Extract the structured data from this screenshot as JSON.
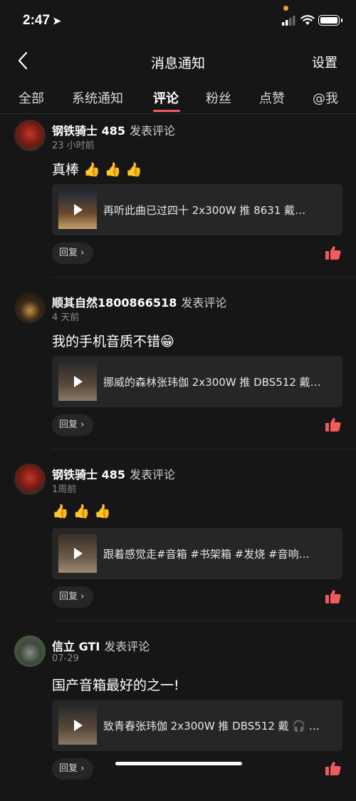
{
  "status_bar": {
    "time": "2:47",
    "location_glyph": "➤"
  },
  "nav": {
    "title": "消息通知",
    "settings": "设置",
    "back_icon": "chevron-left-icon"
  },
  "tabs": [
    {
      "label": "全部"
    },
    {
      "label": "系统通知"
    },
    {
      "label": "评论",
      "active": true
    },
    {
      "label": "粉丝"
    },
    {
      "label": "点赞"
    },
    {
      "label": "@我"
    }
  ],
  "colors": {
    "accent": "#f15a5f",
    "background": "#161616",
    "card": "#262626"
  },
  "comments": [
    {
      "user": "钢铁骑士 485",
      "action": "发表评论",
      "time": "23 小时前",
      "content": "真棒 👍 👍 👍",
      "video_title": "再听此曲已过四十 2x300W 推 8631 戴…",
      "reply": "回复 ›"
    },
    {
      "user": "顺其自然1800866518",
      "action": "发表评论",
      "time": "4 天前",
      "content": "我的手机音质不错😁",
      "video_title": "挪威的森林张玮伽 2x300W 推 DBS512 戴…",
      "reply": "回复 ›"
    },
    {
      "user": "钢铁骑士 485",
      "action": "发表评论",
      "time": "1周前",
      "content": "👍 👍 👍",
      "video_title": "跟着感觉走#音箱 #书架箱 #发烧 #音响…",
      "reply": "回复 ›"
    },
    {
      "user": "信立 GTI",
      "action": "发表评论",
      "time": "07-29",
      "content": "国产音箱最好的之一!",
      "video_title": "致青春张玮伽 2x300W 推 DBS512 戴 🎧 …",
      "reply": "回复 ›"
    }
  ]
}
